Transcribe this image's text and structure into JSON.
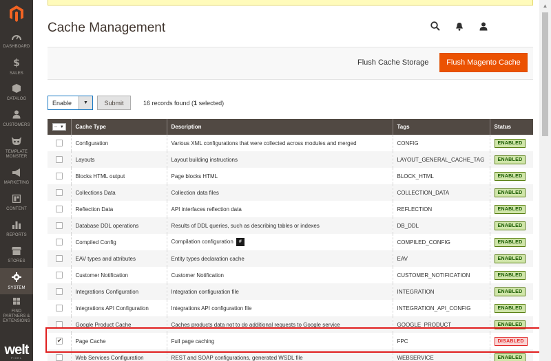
{
  "sidebar": {
    "items": [
      {
        "label": "DASHBOARD",
        "icon": "speedometer-icon"
      },
      {
        "label": "SALES",
        "icon": "dollar-icon"
      },
      {
        "label": "CATALOG",
        "icon": "box-icon"
      },
      {
        "label": "CUSTOMERS",
        "icon": "user-icon"
      },
      {
        "label": "TEMPLATE MONSTER",
        "icon": "monster-icon"
      },
      {
        "label": "MARKETING",
        "icon": "megaphone-icon"
      },
      {
        "label": "CONTENT",
        "icon": "layout-icon"
      },
      {
        "label": "REPORTS",
        "icon": "bar-chart-icon"
      },
      {
        "label": "STORES",
        "icon": "store-icon"
      },
      {
        "label": "SYSTEM",
        "icon": "gear-icon",
        "active": true
      },
      {
        "label": "FIND PARTNERS & EXTENSIONS",
        "icon": "puzzle-icon"
      }
    ],
    "brand": "welt",
    "brand_sub": "PIXEL"
  },
  "header": {
    "title": "Cache Management"
  },
  "actions": {
    "flush_storage": "Flush Cache Storage",
    "flush_magento": "Flush Magento Cache"
  },
  "massaction": {
    "selected": "Enable",
    "submit": "Submit",
    "records_prefix": "16 records found (",
    "records_selected": "1",
    "records_suffix": " selected)"
  },
  "table": {
    "columns": [
      "Cache Type",
      "Description",
      "Tags",
      "Status"
    ],
    "rows": [
      {
        "checked": false,
        "type": "Configuration",
        "description": "Various XML configurations that were collected across modules and merged",
        "tags": "CONFIG",
        "status": "ENABLED"
      },
      {
        "checked": false,
        "type": "Layouts",
        "description": "Layout building instructions",
        "tags": "LAYOUT_GENERAL_CACHE_TAG",
        "status": "ENABLED"
      },
      {
        "checked": false,
        "type": "Blocks HTML output",
        "description": "Page blocks HTML",
        "tags": "BLOCK_HTML",
        "status": "ENABLED"
      },
      {
        "checked": false,
        "type": "Collections Data",
        "description": "Collection data files",
        "tags": "COLLECTION_DATA",
        "status": "ENABLED"
      },
      {
        "checked": false,
        "type": "Reflection Data",
        "description": "API interfaces reflection data",
        "tags": "REFLECTION",
        "status": "ENABLED"
      },
      {
        "checked": false,
        "type": "Database DDL operations",
        "description": "Results of DDL queries, such as describing tables or indexes",
        "tags": "DB_DDL",
        "status": "ENABLED"
      },
      {
        "checked": false,
        "type": "Compiled Config",
        "description": "Compilation configuration",
        "tags": "COMPILED_CONFIG",
        "status": "ENABLED",
        "hash": "#"
      },
      {
        "checked": false,
        "type": "EAV types and attributes",
        "description": "Entity types declaration cache",
        "tags": "EAV",
        "status": "ENABLED"
      },
      {
        "checked": false,
        "type": "Customer Notification",
        "description": "Customer Notification",
        "tags": "CUSTOMER_NOTIFICATION",
        "status": "ENABLED"
      },
      {
        "checked": false,
        "type": "Integrations Configuration",
        "description": "Integration configuration file",
        "tags": "INTEGRATION",
        "status": "ENABLED"
      },
      {
        "checked": false,
        "type": "Integrations API Configuration",
        "description": "Integrations API configuration file",
        "tags": "INTEGRATION_API_CONFIG",
        "status": "ENABLED"
      },
      {
        "checked": false,
        "type": "Google Product Cache",
        "description": "Caches products data not to do additional requests to Google service",
        "tags": "GOOGLE_PRODUCT",
        "status": "ENABLED"
      },
      {
        "checked": true,
        "type": "Page Cache",
        "description": "Full page caching",
        "tags": "FPC",
        "status": "DISABLED"
      },
      {
        "checked": false,
        "type": "Web Services Configuration",
        "description": "REST and SOAP configurations, generated WSDL file",
        "tags": "WEBSERVICE",
        "status": "ENABLED"
      }
    ]
  },
  "colors": {
    "sidebar_bg": "#373330",
    "accent": "#eb5202",
    "header_bg": "#514943",
    "enabled": "#185b00",
    "disabled": "#e22626",
    "highlight": "#e01e1e"
  }
}
